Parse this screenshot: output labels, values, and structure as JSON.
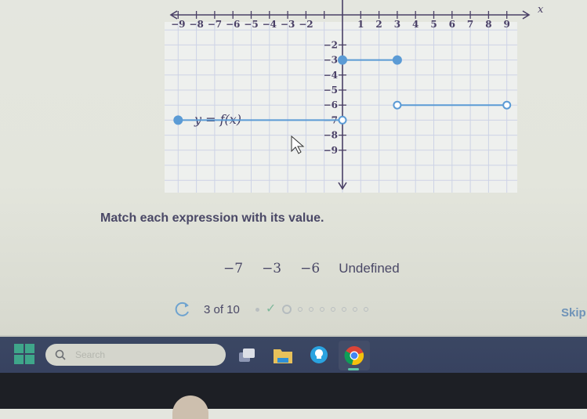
{
  "graph": {
    "function_label": "y = f(x)",
    "x_axis_label": "x",
    "x_ticks_negative": [
      "-9",
      "-8",
      "-7",
      "-6",
      "-5",
      "-4",
      "-3",
      "-2"
    ],
    "x_ticks_positive": [
      "1",
      "2",
      "3",
      "4",
      "5",
      "6",
      "7",
      "8",
      "9"
    ],
    "y_ticks": [
      "-2",
      "-3",
      "-4",
      "-5",
      "-6",
      "-7",
      "-8",
      "-9"
    ],
    "line_color": "#5b9bd5",
    "axis_color": "#4a4066",
    "segments": [
      {
        "x_start": -9,
        "x_end": 0,
        "y": -7,
        "start_closed": true,
        "end_closed": false
      },
      {
        "x_start": 0,
        "x_end": 3,
        "y": -3,
        "start_closed": true,
        "end_closed": true
      },
      {
        "x_start": 3,
        "x_end": 9,
        "y": -6,
        "start_closed": false,
        "end_closed": false
      }
    ]
  },
  "prompt": "Match each expression with its value.",
  "choices": [
    "−7",
    "−3",
    "−6",
    "Undefined"
  ],
  "progress": {
    "label": "3 of 10",
    "current": 3,
    "total": 10,
    "states": [
      "done",
      "correct",
      "current",
      "todo",
      "todo",
      "todo",
      "todo",
      "todo",
      "todo",
      "todo"
    ]
  },
  "skip_label": "Skip",
  "taskbar": {
    "search_placeholder": "Search",
    "apps": [
      "start-icon",
      "task-view-icon",
      "file-explorer-icon",
      "tips-icon",
      "chrome-icon"
    ]
  }
}
